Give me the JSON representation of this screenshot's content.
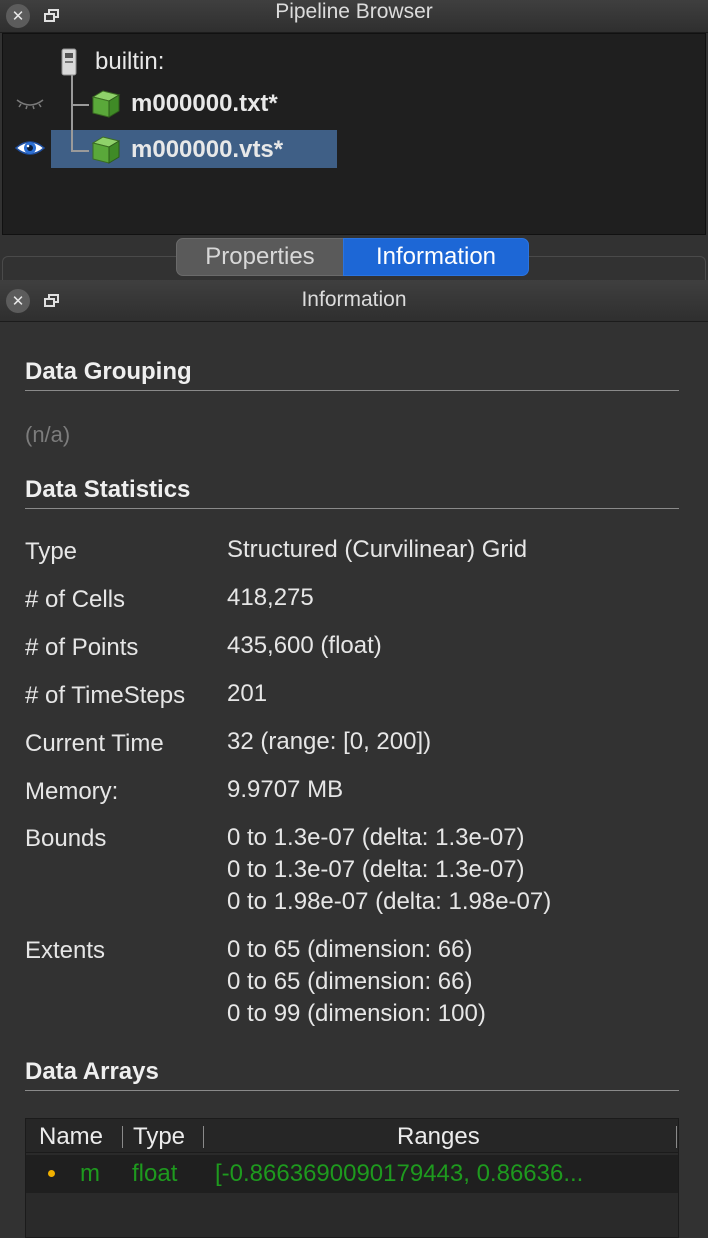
{
  "pipeline_browser": {
    "title": "Pipeline Browser",
    "items": [
      {
        "label": "builtin:"
      },
      {
        "label": "m000000.txt*"
      },
      {
        "label": "m000000.vts*"
      }
    ]
  },
  "tabs": {
    "properties": "Properties",
    "information": "Information"
  },
  "information_panel": {
    "title": "Information",
    "data_grouping": {
      "header": "Data Grouping",
      "value": "(n/a)"
    },
    "data_statistics": {
      "header": "Data Statistics",
      "rows": [
        {
          "label": "Type",
          "value": "Structured (Curvilinear) Grid"
        },
        {
          "label": "# of Cells",
          "value": "418,275"
        },
        {
          "label": "# of Points",
          "value": "435,600 (float)"
        },
        {
          "label": "# of TimeSteps",
          "value": "201"
        },
        {
          "label": "Current Time",
          "value": "32 (range: [0, 200])"
        },
        {
          "label": "Memory:",
          "value": "9.9707 MB"
        }
      ],
      "bounds_label": "Bounds",
      "bounds": [
        "0 to 1.3e-07 (delta: 1.3e-07)",
        "0 to 1.3e-07 (delta: 1.3e-07)",
        "0 to 1.98e-07 (delta: 1.98e-07)"
      ],
      "extents_label": "Extents",
      "extents": [
        "0 to 65 (dimension: 66)",
        "0 to 65 (dimension: 66)",
        "0 to 99 (dimension: 100)"
      ]
    },
    "data_arrays": {
      "header": "Data Arrays",
      "columns": [
        "Name",
        "Type",
        "Ranges"
      ],
      "rows": [
        {
          "name": "m",
          "type": "float",
          "ranges": "[-0.8663690090179443, 0.86636..."
        }
      ]
    }
  },
  "colors": {
    "accent_tab": "#1d67d6",
    "selection": "#3f5f86",
    "array_text": "#1e9a1e"
  }
}
